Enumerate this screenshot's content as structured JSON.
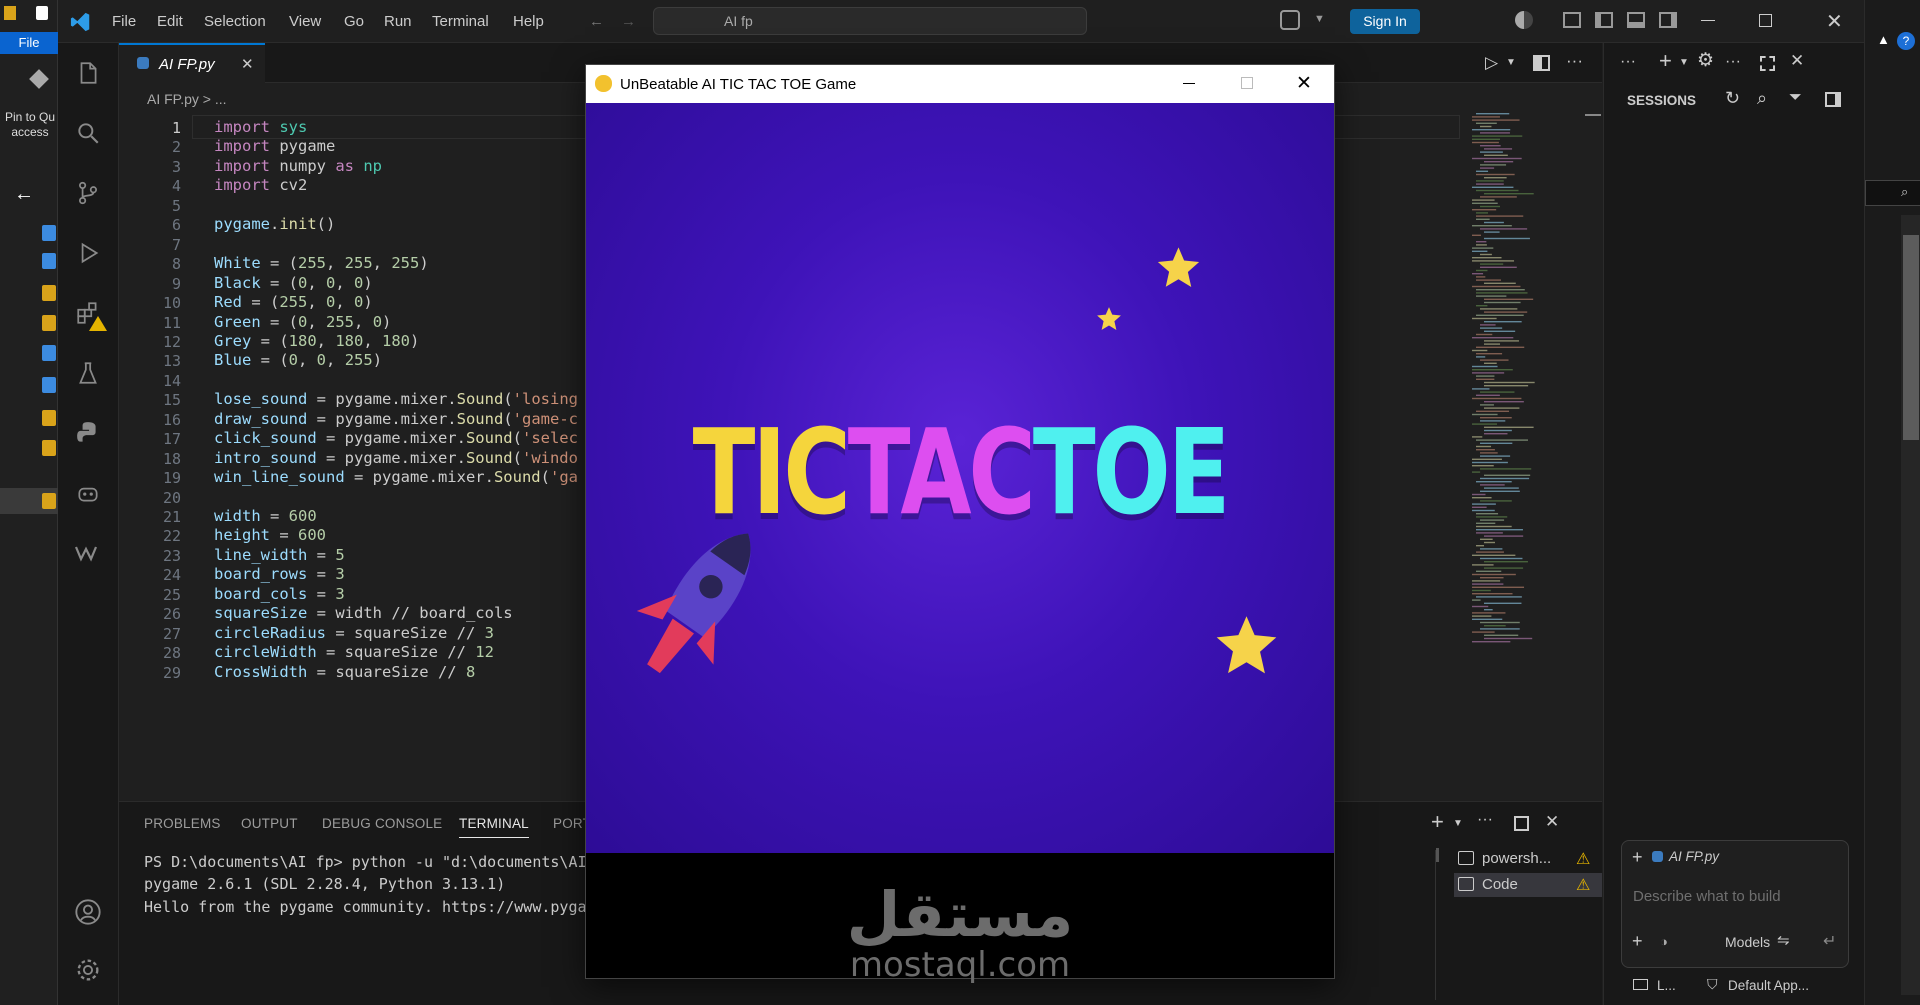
{
  "explorer": {
    "file_tab": "File",
    "pin_label": "Pin to Qu\naccess"
  },
  "menu": [
    "File",
    "Edit",
    "Selection",
    "View",
    "Go",
    "Run",
    "Terminal",
    "Help"
  ],
  "command_center": "AI fp",
  "signin": "Sign In",
  "tab": {
    "label": "AI FP.py"
  },
  "breadcrumb": "AI FP.py > ...",
  "code_lines": [
    [
      [
        "kw",
        "import"
      ],
      [
        "t",
        " "
      ],
      [
        "mod",
        "sys"
      ]
    ],
    [
      [
        "kw",
        "import"
      ],
      [
        "t",
        " pygame"
      ]
    ],
    [
      [
        "kw",
        "import"
      ],
      [
        "t",
        " numpy "
      ],
      [
        "kw",
        "as"
      ],
      [
        "t",
        " "
      ],
      [
        "mod",
        "np"
      ]
    ],
    [
      [
        "kw",
        "import"
      ],
      [
        "t",
        " cv2"
      ]
    ],
    [],
    [
      [
        "t",
        "pygame."
      ],
      [
        "fn",
        "init"
      ],
      [
        "t",
        "()"
      ]
    ],
    [],
    [
      [
        "t",
        "White = ("
      ],
      [
        "num",
        "255"
      ],
      [
        "t",
        ", "
      ],
      [
        "num",
        "255"
      ],
      [
        "t",
        ", "
      ],
      [
        "num",
        "255"
      ],
      [
        "t",
        ")"
      ]
    ],
    [
      [
        "t",
        "Black = ("
      ],
      [
        "num",
        "0"
      ],
      [
        "t",
        ", "
      ],
      [
        "num",
        "0"
      ],
      [
        "t",
        ", "
      ],
      [
        "num",
        "0"
      ],
      [
        "t",
        ")"
      ]
    ],
    [
      [
        "t",
        "Red = ("
      ],
      [
        "num",
        "255"
      ],
      [
        "t",
        ", "
      ],
      [
        "num",
        "0"
      ],
      [
        "t",
        ", "
      ],
      [
        "num",
        "0"
      ],
      [
        "t",
        ")"
      ]
    ],
    [
      [
        "t",
        "Green = ("
      ],
      [
        "num",
        "0"
      ],
      [
        "t",
        ", "
      ],
      [
        "num",
        "255"
      ],
      [
        "t",
        ", "
      ],
      [
        "num",
        "0"
      ],
      [
        "t",
        ")"
      ]
    ],
    [
      [
        "t",
        "Grey = ("
      ],
      [
        "num",
        "180"
      ],
      [
        "t",
        ", "
      ],
      [
        "num",
        "180"
      ],
      [
        "t",
        ", "
      ],
      [
        "num",
        "180"
      ],
      [
        "t",
        ")"
      ]
    ],
    [
      [
        "t",
        "Blue = ("
      ],
      [
        "num",
        "0"
      ],
      [
        "t",
        ", "
      ],
      [
        "num",
        "0"
      ],
      [
        "t",
        ", "
      ],
      [
        "num",
        "255"
      ],
      [
        "t",
        ")"
      ]
    ],
    [],
    [
      [
        "t",
        "lose_sound = pygame.mixer."
      ],
      [
        "fn",
        "Sound"
      ],
      [
        "t",
        "("
      ],
      [
        "str",
        "'losing"
      ]
    ],
    [
      [
        "t",
        "draw_sound = pygame.mixer."
      ],
      [
        "fn",
        "Sound"
      ],
      [
        "t",
        "("
      ],
      [
        "str",
        "'game-c"
      ]
    ],
    [
      [
        "t",
        "click_sound = pygame.mixer."
      ],
      [
        "fn",
        "Sound"
      ],
      [
        "t",
        "("
      ],
      [
        "str",
        "'selec"
      ]
    ],
    [
      [
        "t",
        "intro_sound = pygame.mixer."
      ],
      [
        "fn",
        "Sound"
      ],
      [
        "t",
        "("
      ],
      [
        "str",
        "'windo"
      ]
    ],
    [
      [
        "t",
        "win_line_sound = pygame.mixer."
      ],
      [
        "fn",
        "Sound"
      ],
      [
        "t",
        "("
      ],
      [
        "str",
        "'ga"
      ]
    ],
    [],
    [
      [
        "t",
        "width = "
      ],
      [
        "num",
        "600"
      ]
    ],
    [
      [
        "t",
        "height = "
      ],
      [
        "num",
        "600"
      ]
    ],
    [
      [
        "t",
        "line_width = "
      ],
      [
        "num",
        "5"
      ]
    ],
    [
      [
        "t",
        "board_rows = "
      ],
      [
        "num",
        "3"
      ]
    ],
    [
      [
        "t",
        "board_cols = "
      ],
      [
        "num",
        "3"
      ]
    ],
    [
      [
        "t",
        "squareSize = width // board_cols"
      ]
    ],
    [
      [
        "t",
        "circleRadius = squareSize // "
      ],
      [
        "num",
        "3"
      ]
    ],
    [
      [
        "t",
        "circleWidth = squareSize // "
      ],
      [
        "num",
        "12"
      ]
    ],
    [
      [
        "t",
        "CrossWidth = squareSize // "
      ],
      [
        "num",
        "8"
      ]
    ]
  ],
  "panel": {
    "tabs": [
      "PROBLEMS",
      "OUTPUT",
      "DEBUG CONSOLE",
      "TERMINAL",
      "PORT"
    ],
    "terminal_lines": [
      "PS D:\\documents\\AI fp> python -u \"d:\\documents\\AI",
      "pygame 2.6.1 (SDL 2.28.4, Python 3.13.1)",
      "Hello from the pygame community. https://www.pyga"
    ],
    "terminals": [
      "powersh...",
      "Code"
    ]
  },
  "sessions": {
    "title": "SESSIONS",
    "context_chip": "AI FP.py",
    "placeholder": "Describe what to build",
    "models": "Models",
    "footer_left": "L...",
    "footer_right": "Default App..."
  },
  "game": {
    "window_title": "UnBeatable AI TIC TAC TOE Game",
    "logo_parts": [
      "TIC",
      "TAC",
      "TOE"
    ],
    "logo_colors": [
      "#f5d53c",
      "#dd4ef0",
      "#4ff0ef"
    ]
  },
  "watermark": {
    "arabic": "مستقل",
    "latin": "mostaql.com"
  }
}
